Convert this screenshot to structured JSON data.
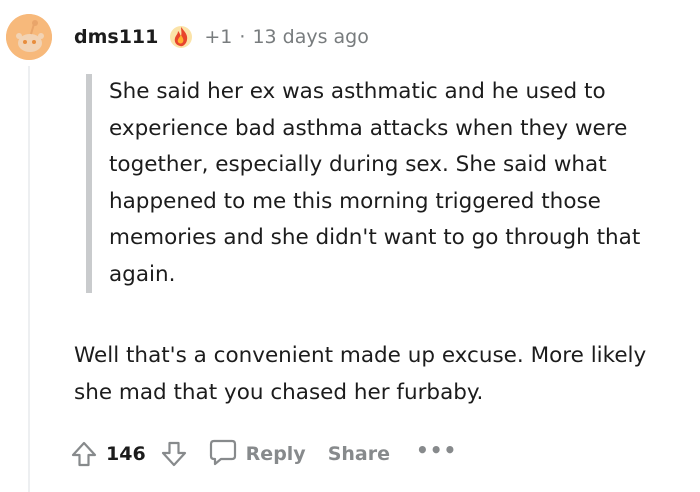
{
  "comment": {
    "username": "dms111",
    "karma_delta": "+1",
    "separator": "·",
    "time_ago": "13 days ago",
    "quote_text": "She said her ex was asthmatic and he used to experience bad asthma attacks when they were together, especially during sex. She said what happened to me this morning triggered those memories and she didn't want to go through that again.",
    "body_text": "Well that's a convenient made up excuse. More likely she mad that you chased her furbaby.",
    "score": "146"
  },
  "actions": {
    "reply_label": "Reply",
    "share_label": "Share",
    "more_label": "•••"
  },
  "colors": {
    "avatar_bg": "#f7b97b",
    "muted_text": "#787c7e",
    "action_text": "#878a8c",
    "quote_bar": "#c9cbcd"
  },
  "icons": {
    "avatar": "reddit-snoo-avatar",
    "award": "award-flame-icon",
    "upvote": "upvote-arrow-icon",
    "downvote": "downvote-arrow-icon",
    "reply": "comment-bubble-icon",
    "more": "more-dots-icon"
  }
}
